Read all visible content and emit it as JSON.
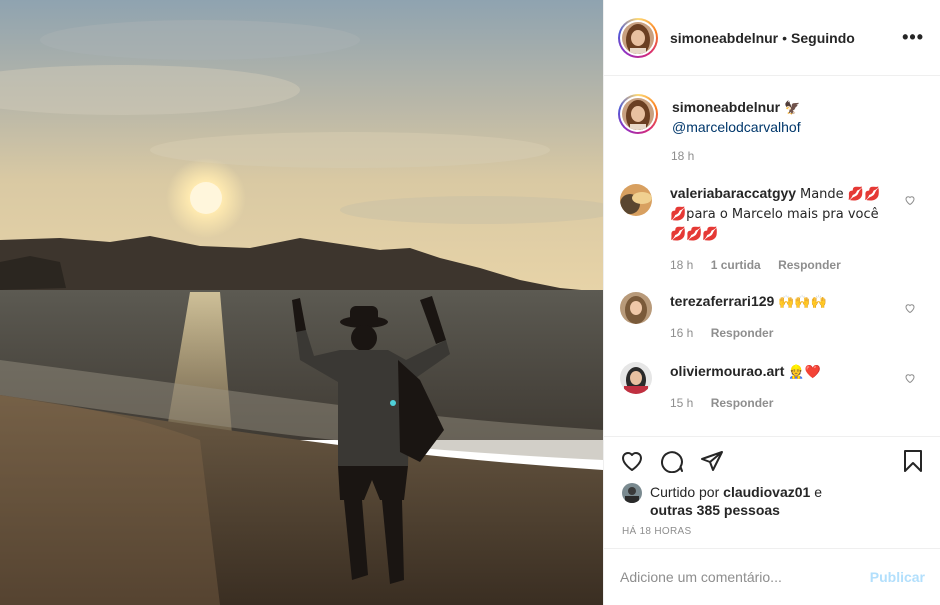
{
  "photo": {
    "description_icon": "sunset-beach-photo"
  },
  "header": {
    "username": "simoneabdelnur",
    "separator": "•",
    "follow_status": "Seguindo",
    "more": "•••"
  },
  "caption": {
    "username": "simoneabdelnur",
    "emoji": "🦅",
    "mention": "@marcelodcarvalhof",
    "time": "18 h"
  },
  "comments": [
    {
      "username": "valeriabaraccatgyy",
      "text": "Mande 💋💋 💋para o Marcelo mais pra você 💋💋💋",
      "time": "18 h",
      "likes": "1 curtida",
      "reply": "Responder"
    },
    {
      "username": "terezaferrari129",
      "text": "🙌🙌🙌",
      "time": "16 h",
      "reply": "Responder"
    },
    {
      "username": "oliviermourao.art",
      "text": "👷❤️",
      "time": "15 h",
      "reply": "Responder"
    }
  ],
  "likes": {
    "prefix": "Curtido por",
    "user": "claudiovaz01",
    "conj": "e",
    "others": "outras 385 pessoas"
  },
  "posted_ago": "HÁ 18 HORAS",
  "add_comment": {
    "placeholder": "Adicione um comentário...",
    "publish": "Publicar"
  },
  "colors": {
    "link": "#00376b",
    "secondary": "#8e8e8e",
    "publish_disabled": "#b2dffc"
  }
}
